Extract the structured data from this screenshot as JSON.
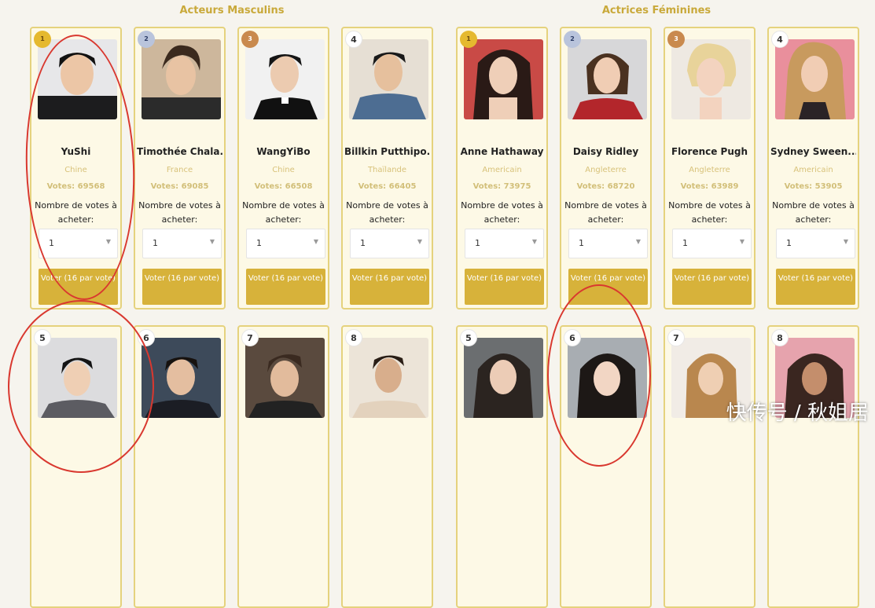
{
  "sections": {
    "men_title": "Acteurs Masculins",
    "women_title": "Actrices Féminines"
  },
  "accent_color": "#d7b23a",
  "men": [
    {
      "rank": "1",
      "name": "YuShi",
      "country": "Chine",
      "votes": "Votes: 69568",
      "buy_label": "Nombre de votes à acheter:",
      "qty": "1",
      "button": "Voter (16 par vote)"
    },
    {
      "rank": "2",
      "name": "Timothée Chala...",
      "country": "France",
      "votes": "Votes: 69085",
      "buy_label": "Nombre de votes à acheter:",
      "qty": "1",
      "button": "Voter (16 par vote)"
    },
    {
      "rank": "3",
      "name": "WangYiBo",
      "country": "Chine",
      "votes": "Votes: 66508",
      "buy_label": "Nombre de votes à acheter:",
      "qty": "1",
      "button": "Voter (16 par vote)"
    },
    {
      "rank": "4",
      "name": "Billkin Putthipo...",
      "country": "Thaïlande",
      "votes": "Votes: 66405",
      "buy_label": "Nombre de votes à acheter:",
      "qty": "1",
      "button": "Voter (16 par vote)"
    }
  ],
  "women": [
    {
      "rank": "1",
      "name": "Anne Hathaway",
      "country": "Americain",
      "votes": "Votes: 73975",
      "buy_label": "Nombre de votes à acheter:",
      "qty": "1",
      "button": "Voter (16 par vote)"
    },
    {
      "rank": "2",
      "name": "Daisy Ridley",
      "country": "Angleterre",
      "votes": "Votes: 68720",
      "buy_label": "Nombre de votes à acheter:",
      "qty": "1",
      "button": "Voter (16 par vote)"
    },
    {
      "rank": "3",
      "name": "Florence Pugh",
      "country": "Angleterre",
      "votes": "Votes: 63989",
      "buy_label": "Nombre de votes à acheter:",
      "qty": "1",
      "button": "Voter (16 par vote)"
    },
    {
      "rank": "4",
      "name": "Sydney Sween...",
      "country": "Americain",
      "votes": "Votes: 53905",
      "buy_label": "Nombre de votes à acheter:",
      "qty": "1",
      "button": "Voter (16 par vote)"
    }
  ],
  "men_row2": [
    {
      "rank": "5"
    },
    {
      "rank": "6"
    },
    {
      "rank": "7"
    },
    {
      "rank": "8"
    }
  ],
  "women_row2": [
    {
      "rank": "5"
    },
    {
      "rank": "6"
    },
    {
      "rank": "7"
    },
    {
      "rank": "8"
    }
  ],
  "watermark": "快传号 / 秋姐居"
}
